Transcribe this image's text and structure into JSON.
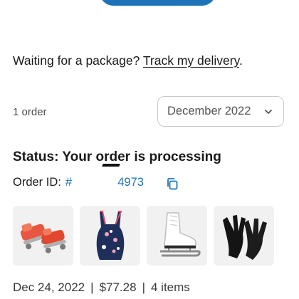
{
  "delivery": {
    "prompt": "Waiting for a package?",
    "link": "Track my delivery",
    "trailing": "."
  },
  "orders": {
    "count_label": "1 order",
    "filter": {
      "selected": "December 2022"
    }
  },
  "order": {
    "status": "Status: Your order is processing",
    "id_label": "Order ID:",
    "id_visible": "#              4973",
    "items": [
      {
        "icon": "roller-skates-thumbnail"
      },
      {
        "icon": "floral-swimsuit-thumbnail"
      },
      {
        "icon": "ice-skate-thumbnail"
      },
      {
        "icon": "gloves-thumbnail"
      }
    ],
    "date": "Dec 24, 2022",
    "total": "$77.28",
    "item_count": "4 items",
    "separator": "|"
  },
  "colors": {
    "accent": "#1e73b8",
    "text": "#1a1a1a",
    "muted": "#555555"
  }
}
